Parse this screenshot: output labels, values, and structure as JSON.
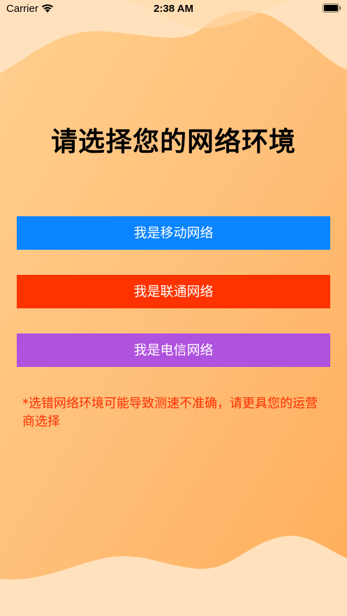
{
  "status_bar": {
    "carrier": "Carrier",
    "time": "2:38 AM",
    "icons": [
      "wifi-icon",
      "battery-icon"
    ]
  },
  "title": "请选择您的网络环境",
  "buttons": {
    "mobile": {
      "label": "我是移动网络",
      "color": "#0a84ff"
    },
    "unicom": {
      "label": "我是联通网络",
      "color": "#ff3300"
    },
    "telecom": {
      "label": "我是电信网络",
      "color": "#af52de"
    }
  },
  "tip": "*选错网络环境可能导致测速不准确，请更具您的运营商选择",
  "colors": {
    "background_light": "#ffe2bd",
    "background_orange": "#ffb15a",
    "tip_text": "#ff2d00"
  }
}
